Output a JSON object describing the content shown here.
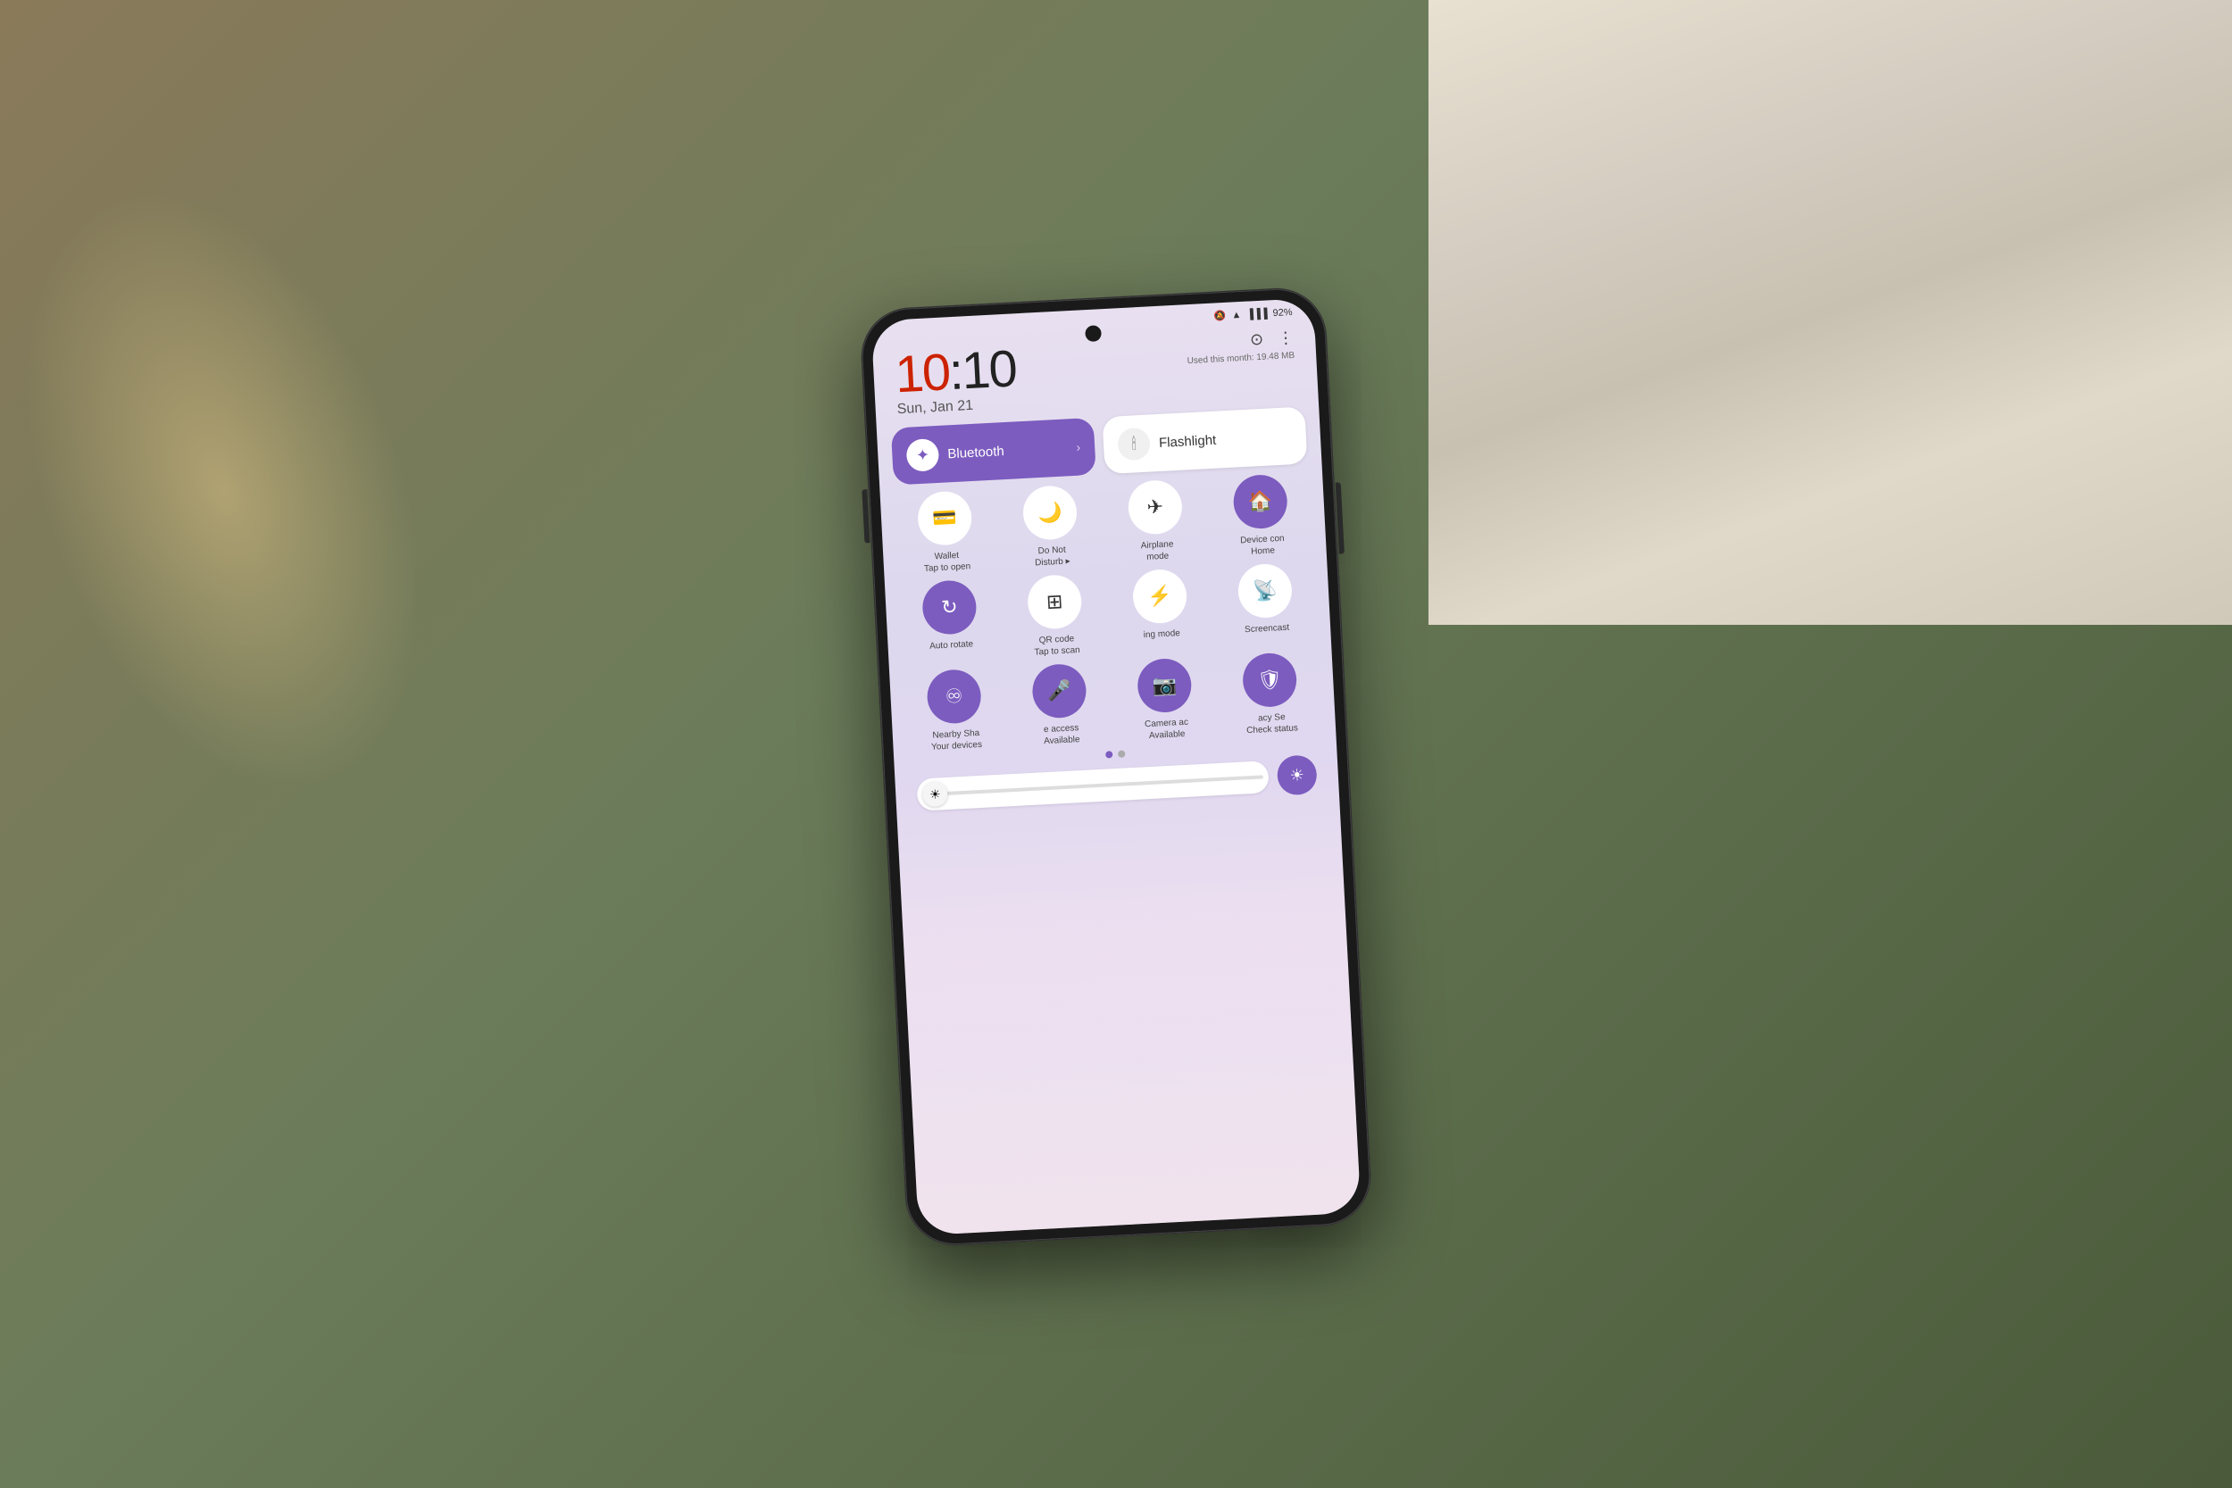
{
  "scene": {
    "bg_color": "#6b7c5a"
  },
  "statusBar": {
    "mute_icon": "🔕",
    "wifi_icon": "📶",
    "signal_icon": "📶",
    "battery_percent": "92%"
  },
  "time": {
    "hour": "10",
    "colon": ":",
    "minute": "10",
    "date": "Sun, Jan 21"
  },
  "header": {
    "camera_icon": "⊙",
    "menu_icon": "⋮",
    "data_usage": "Used this month: 19.48 MB"
  },
  "bluetooth": {
    "label": "Bluetooth",
    "arrow": "›"
  },
  "flashlight": {
    "label": "Flashlight"
  },
  "toggles": [
    {
      "label": "Wallet\nTap to open",
      "icon": "💳",
      "active": false
    },
    {
      "label": "Do Not\nDisturb",
      "icon": "🌙",
      "active": false
    },
    {
      "label": "Airplane\nmode",
      "icon": "✈",
      "active": false
    },
    {
      "label": "Device con\nHome",
      "icon": "🏠",
      "active": true
    },
    {
      "label": "Auto rotate",
      "icon": "↻",
      "active": true
    },
    {
      "label": "QR code\nTap to scan",
      "icon": "▦",
      "active": false
    },
    {
      "label": "ing mode",
      "icon": "⚡",
      "active": false
    },
    {
      "label": "Screencast",
      "icon": "📡",
      "active": false
    },
    {
      "label": "Nearby Sha\nYour devices",
      "icon": "♾",
      "active": true
    },
    {
      "label": "e access\nAvailable",
      "icon": "🎤",
      "active": true
    },
    {
      "label": "Camera ac\nAvailable",
      "icon": "📷",
      "active": true
    },
    {
      "label": "acy Se\nCheck status",
      "icon": "🛡",
      "active": true
    }
  ],
  "brightness": {
    "sun_icon": "☀"
  },
  "dots": {
    "active_index": 0,
    "count": 2
  }
}
